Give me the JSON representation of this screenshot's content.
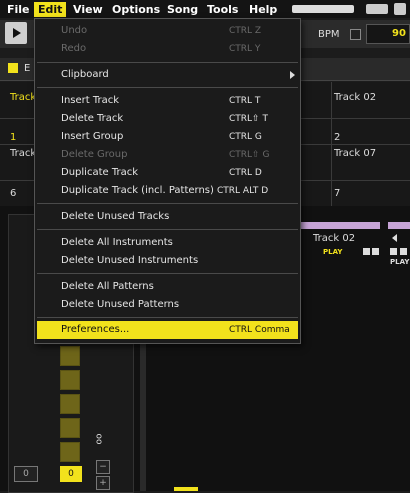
{
  "menubar": {
    "items": [
      "File",
      "Edit",
      "View",
      "Options",
      "Song",
      "Tools",
      "Help"
    ],
    "active": "Edit"
  },
  "toolbar": {
    "bpm_label": "BPM",
    "bpm_value": "90"
  },
  "tabbar": {
    "tab_label": "E"
  },
  "grid": {
    "cells": [
      {
        "text": "Track"
      },
      {
        "text": "1"
      },
      {
        "text": "Track"
      },
      {
        "text": "6"
      },
      {
        "text": "Track 02"
      },
      {
        "text": "2"
      },
      {
        "text": "Track 07"
      },
      {
        "text": "7"
      }
    ]
  },
  "lower": {
    "track_name": "Track 02",
    "play_label_1": "PLAY",
    "play_label_2": "PLAY",
    "oo_label": "oo",
    "stepper_value": "0",
    "counter_value": "0",
    "minus": "−",
    "plus": "+"
  },
  "edit_menu": {
    "items": [
      {
        "label": "Undo",
        "shortcut": "CTRL Z",
        "disabled": true
      },
      {
        "label": "Redo",
        "shortcut": "CTRL Y",
        "disabled": true
      },
      {
        "label": "Clipboard",
        "shortcut": "",
        "submenu": true
      },
      {
        "label": "Insert Track",
        "shortcut": "CTRL T"
      },
      {
        "label": "Delete Track",
        "shortcut": "CTRL⇧ T"
      },
      {
        "label": "Insert Group",
        "shortcut": "CTRL G"
      },
      {
        "label": "Delete Group",
        "shortcut": "CTRL⇧ G",
        "disabled": true
      },
      {
        "label": "Duplicate Track",
        "shortcut": "CTRL D"
      },
      {
        "label": "Duplicate Track (incl. Patterns)",
        "shortcut": "CTRL ALT D"
      },
      {
        "label": "Delete Unused Tracks",
        "shortcut": ""
      },
      {
        "label": "Delete All Instruments",
        "shortcut": ""
      },
      {
        "label": "Delete Unused Instruments",
        "shortcut": ""
      },
      {
        "label": "Delete All Patterns",
        "shortcut": ""
      },
      {
        "label": "Delete Unused Patterns",
        "shortcut": ""
      },
      {
        "label": "Preferences...",
        "shortcut": "CTRL Comma",
        "highlighted": true
      }
    ]
  },
  "colors": {
    "accent": "#f2e21c",
    "menu_bg": "#1b1b1b",
    "disabled": "#6a6a6a"
  }
}
